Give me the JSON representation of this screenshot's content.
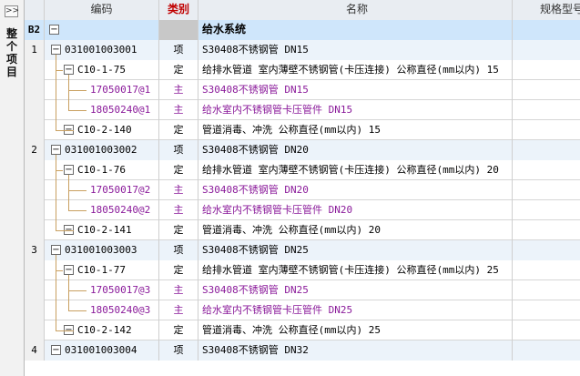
{
  "sidebar": {
    "toggle": ">>",
    "label": "整个项目"
  },
  "columns": {
    "idx": "",
    "code": "编码",
    "type": "类别",
    "name": "名称",
    "spec": "规格型号"
  },
  "system_row": {
    "idx": "B2",
    "name": "给水系统"
  },
  "rows": [
    {
      "idx": "1",
      "code": "031001003001",
      "type": "项",
      "name": "S30408不锈钢管 DN15",
      "level": 0
    },
    {
      "idx": "",
      "code": "C10-1-75",
      "type": "定",
      "name": "给排水管道 室内薄壁不锈钢管(卡压连接) 公称直径(mm以内) 15",
      "level": 1
    },
    {
      "idx": "",
      "code": "17050017@1",
      "type": "主",
      "name": "S30408不锈钢管 DN15",
      "level": 2
    },
    {
      "idx": "",
      "code": "18050240@1",
      "type": "主",
      "name": "给水室内不锈钢管卡压管件 DN15",
      "level": 2
    },
    {
      "idx": "",
      "code": "C10-2-140",
      "type": "定",
      "name": "管道消毒、冲洗 公称直径(mm以内) 15",
      "level": 1
    },
    {
      "idx": "2",
      "code": "031001003002",
      "type": "项",
      "name": "S30408不锈钢管 DN20",
      "level": 0
    },
    {
      "idx": "",
      "code": "C10-1-76",
      "type": "定",
      "name": "给排水管道 室内薄壁不锈钢管(卡压连接) 公称直径(mm以内) 20",
      "level": 1
    },
    {
      "idx": "",
      "code": "17050017@2",
      "type": "主",
      "name": "S30408不锈钢管 DN20",
      "level": 2
    },
    {
      "idx": "",
      "code": "18050240@2",
      "type": "主",
      "name": "给水室内不锈钢管卡压管件 DN20",
      "level": 2
    },
    {
      "idx": "",
      "code": "C10-2-141",
      "type": "定",
      "name": "管道消毒、冲洗 公称直径(mm以内) 20",
      "level": 1
    },
    {
      "idx": "3",
      "code": "031001003003",
      "type": "项",
      "name": "S30408不锈钢管 DN25",
      "level": 0
    },
    {
      "idx": "",
      "code": "C10-1-77",
      "type": "定",
      "name": "给排水管道 室内薄壁不锈钢管(卡压连接) 公称直径(mm以内) 25",
      "level": 1
    },
    {
      "idx": "",
      "code": "17050017@3",
      "type": "主",
      "name": "S30408不锈钢管 DN25",
      "level": 2
    },
    {
      "idx": "",
      "code": "18050240@3",
      "type": "主",
      "name": "给水室内不锈钢管卡压管件 DN25",
      "level": 2
    },
    {
      "idx": "",
      "code": "C10-2-142",
      "type": "定",
      "name": "管道消毒、冲洗 公称直径(mm以内) 25",
      "level": 1
    },
    {
      "idx": "4",
      "code": "031001003004",
      "type": "项",
      "name": "S30408不锈钢管 DN32",
      "level": 0
    }
  ],
  "tree_toggle": "−",
  "colors": {
    "sys_bg": "#cfe6fb",
    "top_bg": "#ecf3fa",
    "purple": "#8a1a9a",
    "tree_line": "#c9a060"
  }
}
